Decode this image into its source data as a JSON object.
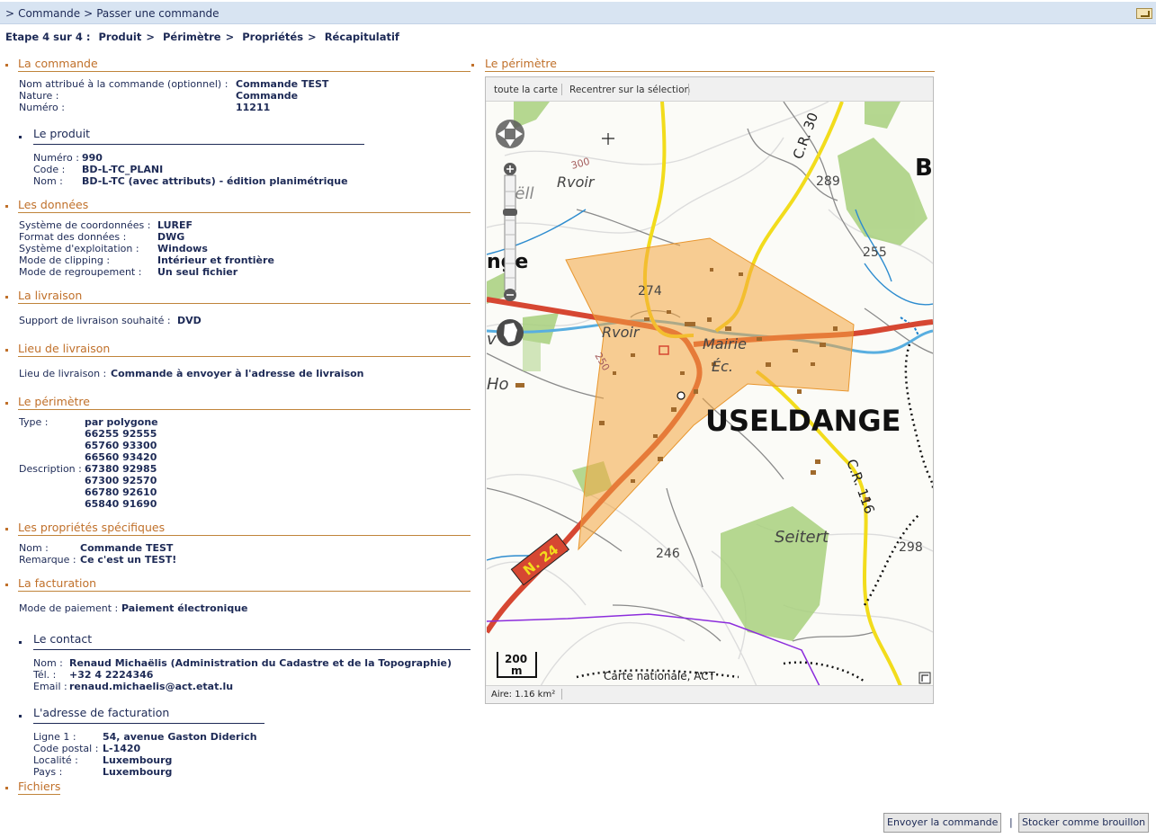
{
  "breadcrumb": {
    "sep1": ">",
    "item1": "Commande",
    "sep2": ">",
    "item2": "Passer une commande"
  },
  "steps": {
    "label": "Etape 4 sur 4 :",
    "s1": "Produit",
    "s2": "Périmètre",
    "s3": "Propriétés",
    "s4": "Récapitulatif",
    "sep": ">"
  },
  "commande": {
    "title": "La commande",
    "nom_label": "Nom attribué à la commande (optionnel) :",
    "nom_value": "Commande TEST",
    "nature_label": "Nature :",
    "nature_value": "Commande",
    "numero_label": "Numéro :",
    "numero_value": "11211"
  },
  "produit": {
    "title": "Le produit",
    "numero_label": "Numéro :",
    "numero_value": "990",
    "code_label": "Code :",
    "code_value": "BD-L-TC_PLANI",
    "nom_label": "Nom :",
    "nom_value": "BD-L-TC (avec attributs) - édition planimétrique"
  },
  "donnees": {
    "title": "Les données",
    "rows": [
      {
        "label": "Système de coordonnées :",
        "value": "LUREF"
      },
      {
        "label": "Format des données :",
        "value": "DWG"
      },
      {
        "label": "Système d'exploitation :",
        "value": "Windows"
      },
      {
        "label": "Mode de clipping :",
        "value": "Intérieur et frontière"
      },
      {
        "label": "Mode de regroupement :",
        "value": "Un seul fichier"
      }
    ]
  },
  "livraison": {
    "title": "La livraison",
    "label": "Support de livraison souhaité :",
    "value": "DVD"
  },
  "lieu": {
    "title": "Lieu de livraison",
    "label": "Lieu de livraison :",
    "value": "Commande à envoyer à l'adresse de livraison"
  },
  "perimetre": {
    "title": "Le périmètre",
    "type_label": "Type :",
    "type_value": "par polygone",
    "desc_label": "Description :",
    "coords": [
      "66255 92555",
      "65760 93300",
      "66560 93420",
      "67380 92985",
      "67300 92570",
      "66780 92610",
      "65840 91690"
    ]
  },
  "proprietes": {
    "title": "Les propriétés spécifiques",
    "nom_label": "Nom :",
    "nom_value": "Commande TEST",
    "remarque_label": "Remarque :",
    "remarque_value": "Ce c'est un TEST!"
  },
  "facturation": {
    "title": "La facturation",
    "label": "Mode de paiement :",
    "value": "Paiement électronique"
  },
  "contact": {
    "title": "Le contact",
    "nom_label": "Nom :",
    "nom_value": "Renaud Michaëlis (Administration du Cadastre et de la Topographie)",
    "tel_label": "Tél. :",
    "tel_value": "+32 4 2224346",
    "email_label": "Email :",
    "email_value": "renaud.michaelis@act.etat.lu"
  },
  "adresse": {
    "title": "L'adresse de facturation",
    "ligne_label": "Ligne 1 :",
    "ligne_value": "54, avenue Gaston Diderich",
    "cp_label": "Code postal :",
    "cp_value": "L-1420",
    "localite_label": "Localité :",
    "localite_value": "Luxembourg",
    "pays_label": "Pays :",
    "pays_value": "Luxembourg"
  },
  "fichiers": {
    "title": "Fichiers"
  },
  "map": {
    "section_title": "Le périmètre",
    "tool_full": "toute la carte",
    "tool_recenter": "Recentrer sur la sélection",
    "area": "Aire: 1.16 km²",
    "scale": "200",
    "scale_unit": "m",
    "attribution": "Carte nationale, ACT",
    "labels": {
      "town": "USELDANGE",
      "cr30": "C.R. 30",
      "cr116": "C.R. 116",
      "n24": "N. 24",
      "rvoir1": "Rvoir",
      "rvoir2": "Rvoir",
      "mairie": "Mairie",
      "ec": "Éc.",
      "seitert": "Seitert",
      "sell": "Sëll",
      "nge": "nge",
      "ho": "Ho",
      "v": "v",
      "b": "B",
      "h274": "274",
      "h289": "289",
      "h255": "255",
      "h246": "246",
      "h298": "298",
      "h300": "300",
      "h250": "250"
    }
  },
  "buttons": {
    "send": "Envoyer la commande",
    "sep": "|",
    "draft": "Stocker comme brouillon"
  }
}
